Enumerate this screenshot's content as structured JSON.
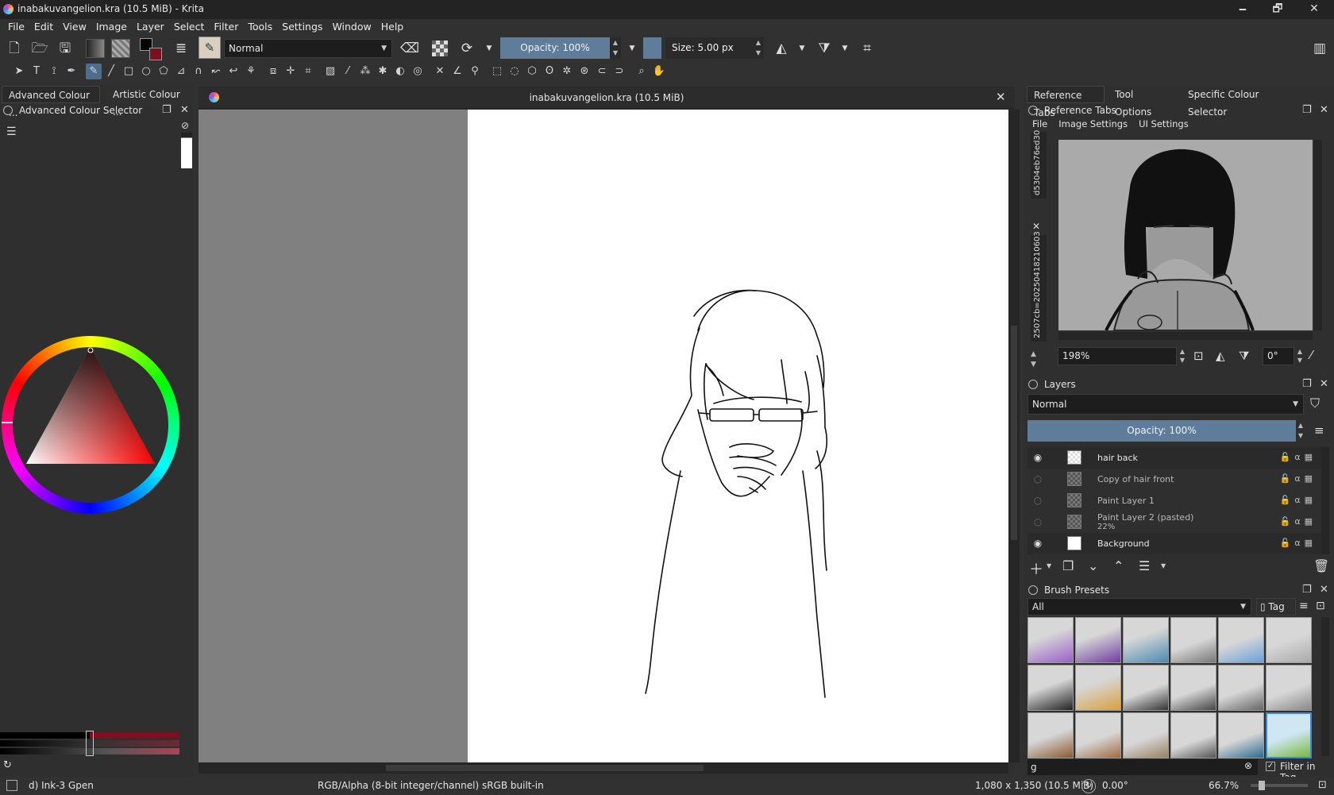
{
  "window": {
    "title": "inabakuvangelion.kra (10.5 MiB) - Krita",
    "minimize": "🗕",
    "maximize": "🗗",
    "close": "✕"
  },
  "menu": [
    "File",
    "Edit",
    "View",
    "Image",
    "Layer",
    "Select",
    "Filter",
    "Tools",
    "Settings",
    "Window",
    "Help"
  ],
  "toolbar": {
    "blend_mode": "Normal",
    "opacity_label": "Opacity: 100%",
    "size_label": "Size: 5.00 px",
    "brush_color": "#5f7d9b"
  },
  "left_docker": {
    "tabs": [
      "Advanced Colour ...",
      "Artistic Colour ..."
    ],
    "title": "Advanced Colour Selector"
  },
  "canvas": {
    "tab_title": "inabakuvangelion.kra (10.5 MiB)",
    "close": "✕"
  },
  "right_docker": {
    "tabs": [
      "Reference Tabs",
      "Tool Options",
      "Specific Colour Selector"
    ],
    "reference": {
      "title": "Reference Tabs",
      "menus": [
        "File",
        "Image Settings",
        "UI Settings"
      ],
      "side_tab_1": "d5304eb76ed30",
      "side_tab_2": "2507cb=20250418210603",
      "zoom": "198%",
      "rotation": "0°"
    },
    "layers": {
      "title": "Layers",
      "blend_mode": "Normal",
      "opacity": "Opacity:  100%",
      "items": [
        {
          "name": "hair back",
          "visible": true
        },
        {
          "name": "Copy of hair front",
          "visible": false
        },
        {
          "name": "Paint Layer 1",
          "visible": false
        },
        {
          "name": "Paint Layer 2 (pasted)",
          "sub": "22%",
          "visible": false
        },
        {
          "name": "Background",
          "visible": true
        }
      ]
    },
    "brush_presets": {
      "title": "Brush Presets",
      "filter": "All",
      "tag": "Tag",
      "search": "g",
      "filter_in_tag": "Filter in Tag"
    }
  },
  "status": {
    "brush": "d) Ink-3 Gpen",
    "color_model": "RGB/Alpha (8-bit integer/channel)  sRGB built-in",
    "dimensions": "1,080 x 1,350 (10.5 MiB)",
    "rotation": "0.00°",
    "zoom": "66.7%"
  }
}
